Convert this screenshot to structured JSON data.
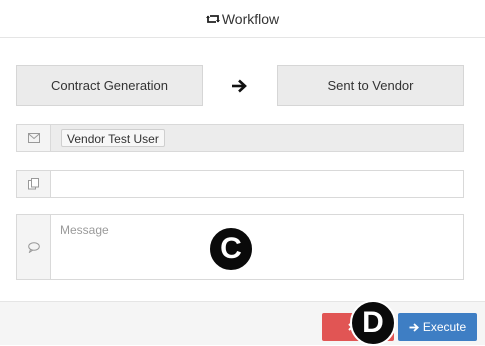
{
  "header": {
    "title": "Workflow",
    "icon": "retweet-icon"
  },
  "stages": {
    "from_label": "Contract Generation",
    "arrow_icon": "arrow-right-icon",
    "to_label": "Sent to Vendor"
  },
  "form": {
    "to": {
      "icon": "envelope-icon",
      "recipient": "Vendor Test User"
    },
    "cc": {
      "icon": "copy-icon",
      "value": ""
    },
    "message": {
      "icon": "comment-icon",
      "placeholder": "Message",
      "value": ""
    }
  },
  "footer": {
    "cancel_label": "C",
    "cancel_icon": "times-icon",
    "execute_label": "Execute",
    "execute_icon": "arrow-right-icon"
  },
  "markers": {
    "c": "C",
    "d": "D"
  },
  "colors": {
    "cancel": "#e15554",
    "execute": "#3e7ec4",
    "stage_bg": "#ebebeb"
  }
}
